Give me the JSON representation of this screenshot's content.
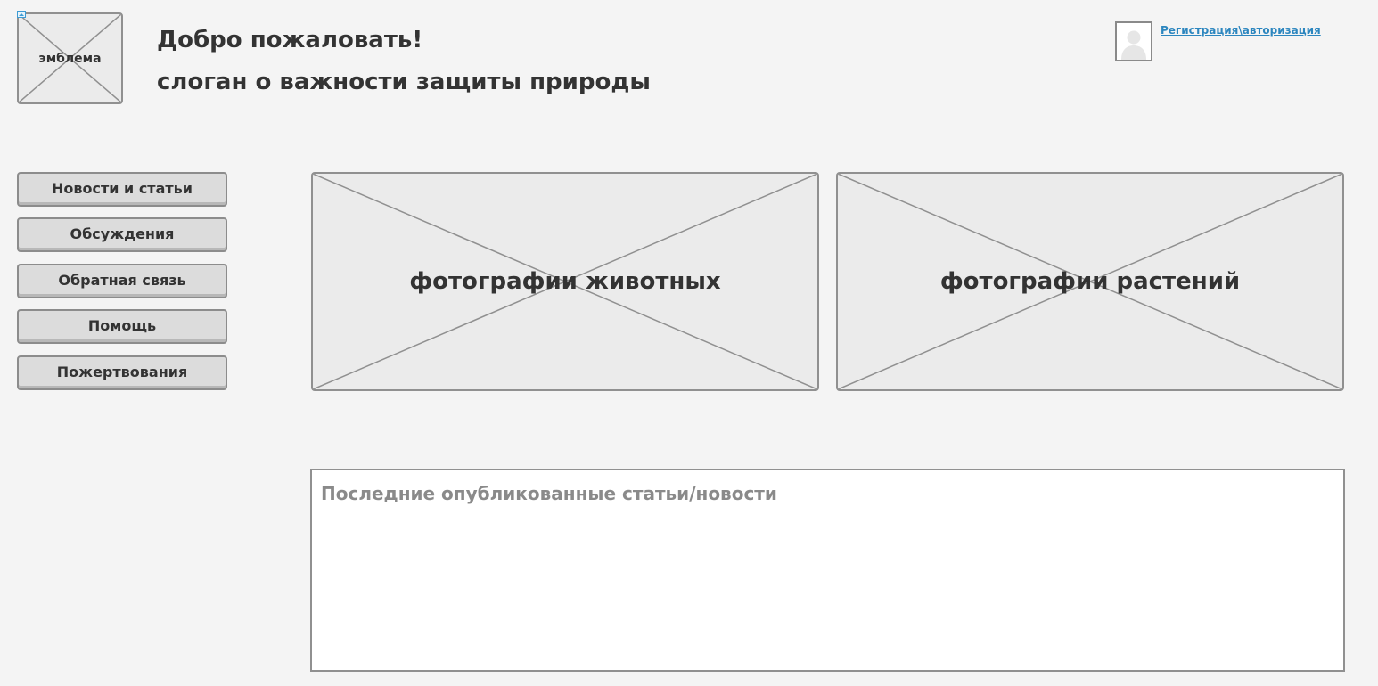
{
  "header": {
    "logo_label": "эмблема",
    "welcome": "Добро пожаловать!",
    "slogan": "слоган о важности защиты природы",
    "auth_link": "Регистрация\\авторизация"
  },
  "nav": {
    "items": [
      {
        "label": "Новости и статьи"
      },
      {
        "label": "Обсуждения"
      },
      {
        "label": "Обратная связь"
      },
      {
        "label": "Помощь"
      },
      {
        "label": "Пожертвования"
      }
    ]
  },
  "gallery": {
    "animals_label": "фотографии животных",
    "plants_label": "фотографии растений"
  },
  "news": {
    "title": "Последние опубликованные статьи/новости"
  },
  "colors": {
    "background": "#f4f4f4",
    "placeholder_fill": "#ebebeb",
    "border": "#909090",
    "link": "#2c86bf",
    "text": "#333333",
    "muted_text": "#8a8a8a"
  }
}
